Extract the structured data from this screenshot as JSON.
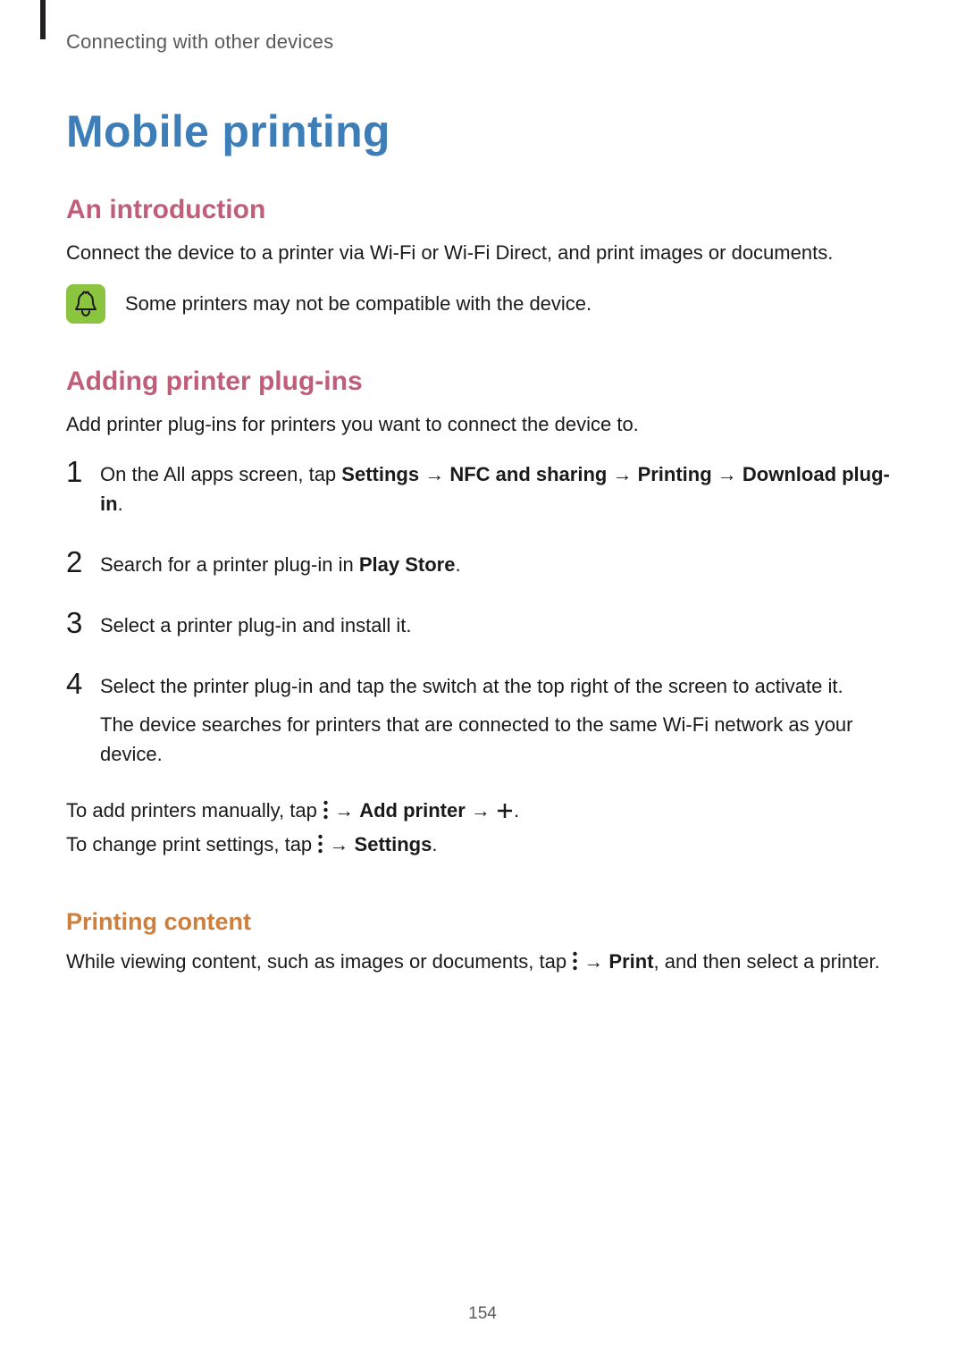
{
  "breadcrumb": "Connecting with other devices",
  "title": "Mobile printing",
  "intro": {
    "heading": "An introduction",
    "body": "Connect the device to a printer via Wi-Fi or Wi-Fi Direct, and print images or documents.",
    "note": "Some printers may not be compatible with the device."
  },
  "plugins": {
    "heading": "Adding printer plug-ins",
    "body": "Add printer plug-ins for printers you want to connect the device to.",
    "steps": {
      "s1": {
        "num": "1",
        "a": "On the All apps screen, tap ",
        "b": "Settings",
        "c": " → ",
        "d": "NFC and sharing",
        "e": " → ",
        "f": "Printing",
        "g": " → ",
        "h": "Download plug-in",
        "i": "."
      },
      "s2": {
        "num": "2",
        "a": "Search for a printer plug-in in ",
        "b": "Play Store",
        "c": "."
      },
      "s3": {
        "num": "3",
        "a": "Select a printer plug-in and install it."
      },
      "s4": {
        "num": "4",
        "a": "Select the printer plug-in and tap the switch at the top right of the screen to activate it.",
        "b": "The device searches for printers that are connected to the same Wi-Fi network as your device."
      }
    },
    "manual": {
      "a": "To add printers manually, tap ",
      "b": " → ",
      "c": "Add printer",
      "d": " → ",
      "e": "."
    },
    "settings": {
      "a": "To change print settings, tap ",
      "b": " → ",
      "c": "Settings",
      "d": "."
    }
  },
  "printing": {
    "heading": "Printing content",
    "a": "While viewing content, such as images or documents, tap ",
    "b": " → ",
    "c": "Print",
    "d": ", and then select a printer."
  },
  "page_number": "154"
}
